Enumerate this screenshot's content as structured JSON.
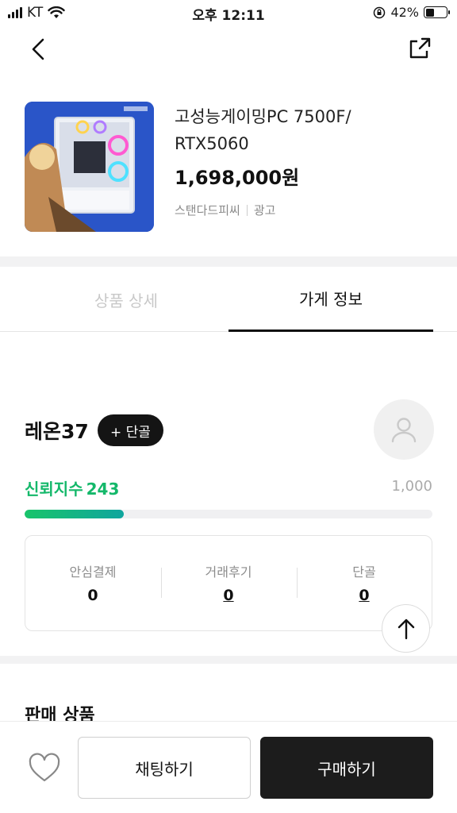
{
  "status_bar": {
    "carrier": "KT",
    "time": "오후 12:11",
    "battery_percent": "42%",
    "battery_level": 0.42
  },
  "header": {
    "back_icon": "chevron-left-icon",
    "share_icon": "share-external-icon"
  },
  "product": {
    "name": "고성능게이밍PC 7500F/ RTX5060",
    "price": "1,698,000원",
    "seller": "스탠다드피씨",
    "ad_label": "광고"
  },
  "tabs": [
    {
      "label": "상품 상세",
      "active": false
    },
    {
      "label": "가게 정보",
      "active": true
    }
  ],
  "store": {
    "name": "레온37",
    "regular_button": "+ 단골",
    "trust_label": "신뢰지수",
    "trust_value": "243",
    "trust_max": "1,000",
    "trust_ratio": 0.243,
    "stats": [
      {
        "label": "안심결제",
        "value": "0"
      },
      {
        "label": "거래후기",
        "value": "0"
      },
      {
        "label": "단골",
        "value": "0"
      }
    ]
  },
  "sections": {
    "sales_products_title": "판매 상품"
  },
  "bottom_bar": {
    "heart_icon": "heart-icon",
    "chat_label": "채팅하기",
    "buy_label": "구매하기"
  },
  "colors": {
    "accent_green": "#14b86a",
    "dark_button": "#1c1c1c"
  }
}
